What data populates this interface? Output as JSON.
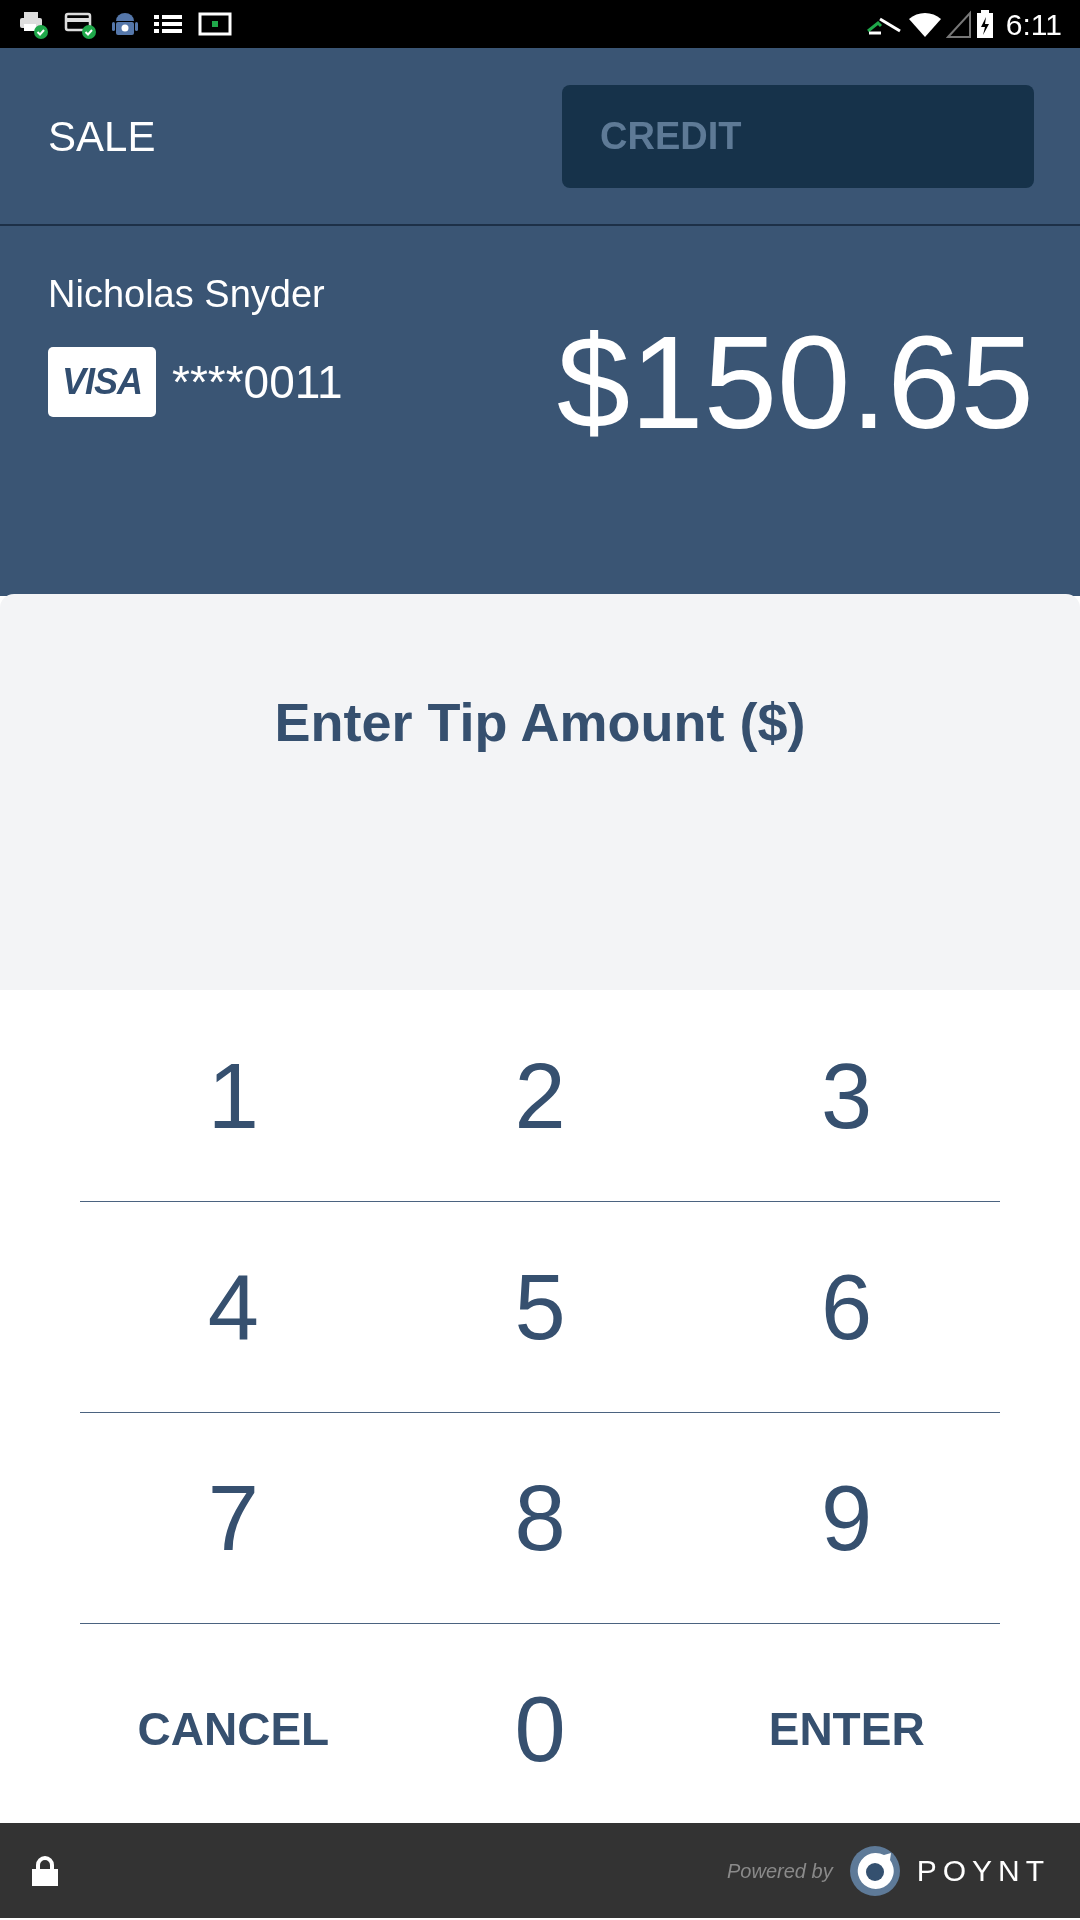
{
  "status_bar": {
    "time": "6:11"
  },
  "header": {
    "title": "SALE",
    "payment_type": "CREDIT"
  },
  "card": {
    "holder": "Nicholas Snyder",
    "brand": "VISA",
    "number": "****0011",
    "amount": "$150.65"
  },
  "prompt": {
    "title": "Enter Tip Amount ($)"
  },
  "keypad": [
    [
      {
        "label": "1",
        "kind": "digit"
      },
      {
        "label": "2",
        "kind": "digit"
      },
      {
        "label": "3",
        "kind": "digit"
      }
    ],
    [
      {
        "label": "4",
        "kind": "digit"
      },
      {
        "label": "5",
        "kind": "digit"
      },
      {
        "label": "6",
        "kind": "digit"
      }
    ],
    [
      {
        "label": "7",
        "kind": "digit"
      },
      {
        "label": "8",
        "kind": "digit"
      },
      {
        "label": "9",
        "kind": "digit"
      }
    ],
    [
      {
        "label": "CANCEL",
        "kind": "action"
      },
      {
        "label": "0",
        "kind": "digit"
      },
      {
        "label": "ENTER",
        "kind": "action"
      }
    ]
  ],
  "footer": {
    "powered_by": "Powered by",
    "brand": "POYNT"
  }
}
